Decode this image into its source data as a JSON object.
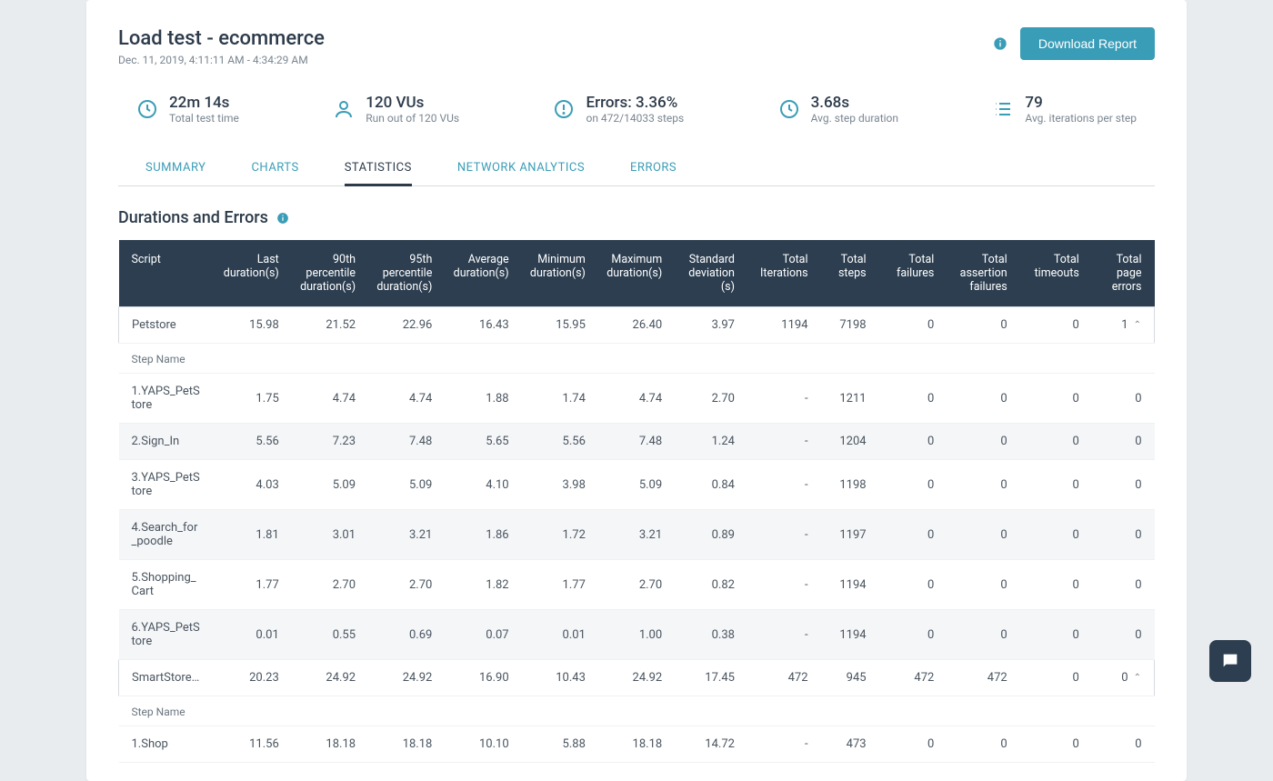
{
  "header": {
    "title": "Load test - ecommerce",
    "subtitle": "Dec. 11, 2019, 4:11:11 AM - 4:34:29 AM",
    "download_label": "Download Report"
  },
  "metrics": {
    "time": {
      "value": "22m 14s",
      "label": "Total test time"
    },
    "vus": {
      "value": "120 VUs",
      "label": "Run out of 120 VUs"
    },
    "errors": {
      "value": "Errors: 3.36%",
      "label": "on 472/14033 steps"
    },
    "avg_step": {
      "value": "3.68s",
      "label": "Avg. step duration"
    },
    "iterations": {
      "value": "79",
      "label": "Avg. iterations per step"
    }
  },
  "tabs": {
    "summary": "SUMMARY",
    "charts": "CHARTS",
    "statistics": "STATISTICS",
    "network": "NETWORK ANALYTICS",
    "errors": "ERRORS"
  },
  "section_title": "Durations and Errors",
  "columns": {
    "script": "Script",
    "last": "Last duration(s)",
    "p90": "90th percentile duration(s)",
    "p95": "95th percentile duration(s)",
    "avg": "Average duration(s)",
    "min": "Minimum duration(s)",
    "max": "Maximum duration(s)",
    "std": "Standard deviation (s)",
    "iter": "Total Iterations",
    "steps": "Total steps",
    "fail": "Total failures",
    "assert": "Total assertion failures",
    "timeout": "Total timeouts",
    "page_err": "Total page errors"
  },
  "step_name_label": "Step Name",
  "rows": [
    {
      "type": "parent",
      "cells": [
        "Petstore",
        "15.98",
        "21.52",
        "22.96",
        "16.43",
        "15.95",
        "26.40",
        "3.97",
        "1194",
        "7198",
        "0",
        "0",
        "0",
        "1"
      ],
      "expand": true
    },
    {
      "type": "step-header"
    },
    {
      "type": "step",
      "cells": [
        "1.YAPS_PetStore",
        "1.75",
        "4.74",
        "4.74",
        "1.88",
        "1.74",
        "4.74",
        "2.70",
        "-",
        "1211",
        "0",
        "0",
        "0",
        "0"
      ]
    },
    {
      "type": "step",
      "alt": true,
      "cells": [
        "2.Sign_In",
        "5.56",
        "7.23",
        "7.48",
        "5.65",
        "5.56",
        "7.48",
        "1.24",
        "-",
        "1204",
        "0",
        "0",
        "0",
        "0"
      ]
    },
    {
      "type": "step",
      "cells": [
        "3.YAPS_PetStore",
        "4.03",
        "5.09",
        "5.09",
        "4.10",
        "3.98",
        "5.09",
        "0.84",
        "-",
        "1198",
        "0",
        "0",
        "0",
        "0"
      ]
    },
    {
      "type": "step",
      "alt": true,
      "cells": [
        "4.Search_for_poodle",
        "1.81",
        "3.01",
        "3.21",
        "1.86",
        "1.72",
        "3.21",
        "0.89",
        "-",
        "1197",
        "0",
        "0",
        "0",
        "0"
      ]
    },
    {
      "type": "step",
      "cells": [
        "5.Shopping_Cart",
        "1.77",
        "2.70",
        "2.70",
        "1.82",
        "1.77",
        "2.70",
        "0.82",
        "-",
        "1194",
        "0",
        "0",
        "0",
        "0"
      ]
    },
    {
      "type": "step",
      "alt": true,
      "cells": [
        "6.YAPS_PetStore",
        "0.01",
        "0.55",
        "0.69",
        "0.07",
        "0.01",
        "1.00",
        "0.38",
        "-",
        "1194",
        "0",
        "0",
        "0",
        "0"
      ]
    },
    {
      "type": "parent",
      "cells": [
        "SmartStore---...",
        "20.23",
        "24.92",
        "24.92",
        "16.90",
        "10.43",
        "24.92",
        "17.45",
        "472",
        "945",
        "472",
        "472",
        "0",
        "0"
      ],
      "expand": true
    },
    {
      "type": "step-header"
    },
    {
      "type": "step",
      "cells": [
        "1.Shop",
        "11.56",
        "18.18",
        "18.18",
        "10.10",
        "5.88",
        "18.18",
        "14.72",
        "-",
        "473",
        "0",
        "0",
        "0",
        "0"
      ]
    }
  ]
}
